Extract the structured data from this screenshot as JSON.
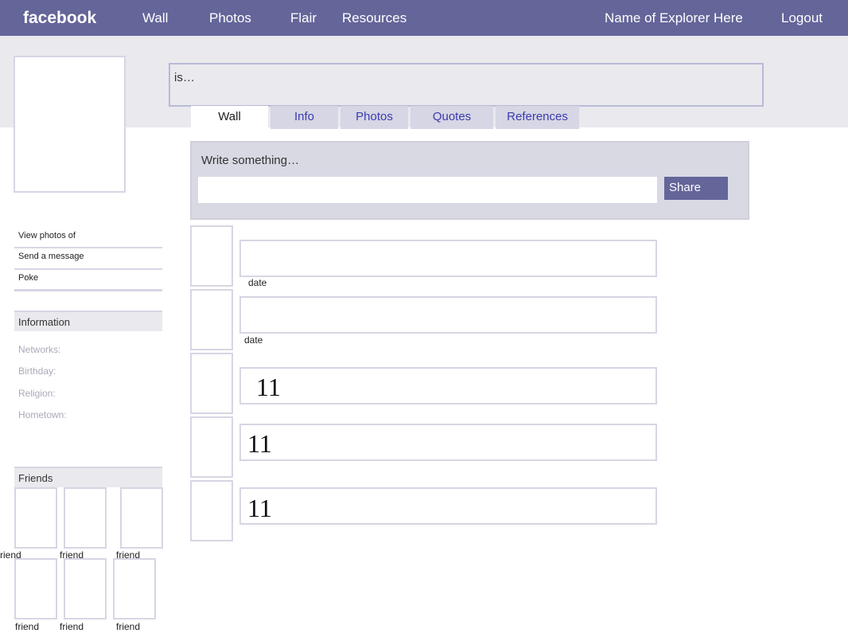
{
  "topbar": {
    "logo": "facebook",
    "nav": [
      "Wall",
      "Photos",
      "Flair",
      "Resources"
    ],
    "user_name": "Name of Explorer Here",
    "logout": "Logout"
  },
  "status": {
    "text": "is…"
  },
  "tabs": [
    "Wall",
    "Info",
    "Photos",
    "Quotes",
    "References"
  ],
  "composer": {
    "label": "Write something…",
    "input_value": "",
    "share_label": "Share"
  },
  "sidebar": {
    "links": [
      "View photos of",
      "Send a message",
      "Poke"
    ],
    "information": {
      "heading": "Information",
      "items": [
        "Networks:",
        "Birthday:",
        "Religion:",
        "Hometown:"
      ]
    },
    "friends": {
      "heading": "Friends",
      "names": [
        "riend",
        "friend",
        "friend",
        "friend",
        "friend",
        "friend"
      ]
    }
  },
  "wall": {
    "posts": [
      {
        "text": "",
        "date": "date"
      },
      {
        "text": "",
        "date": "date"
      },
      {
        "text": "11",
        "date": ""
      },
      {
        "text": "11",
        "date": ""
      },
      {
        "text": "11",
        "date": ""
      }
    ]
  },
  "colors": {
    "brand": "#646599",
    "band": "#e9e9ee",
    "tab_inactive": "#d6d6e4",
    "link_blue": "#3b3bb0"
  }
}
